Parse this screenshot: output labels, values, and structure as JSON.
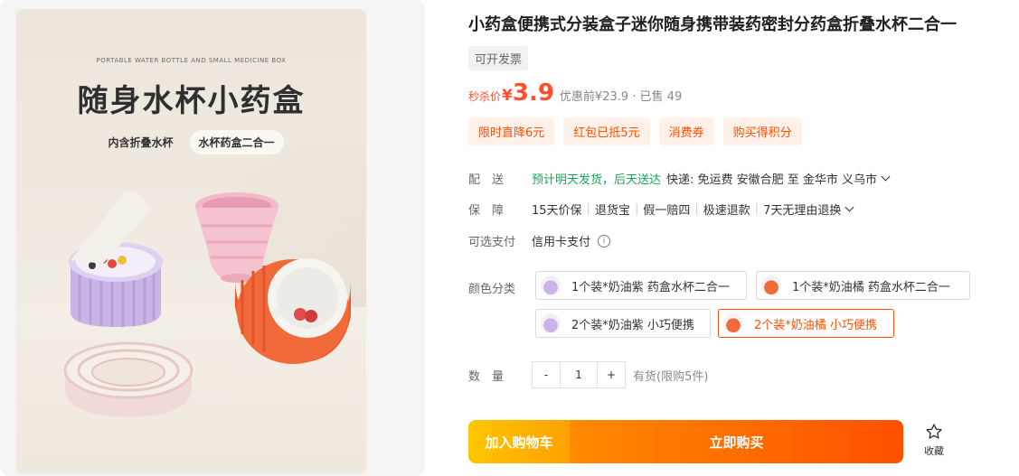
{
  "hero": {
    "subtitle_en": "PORTABLE WATER BOTTLE AND SMALL MEDICINE BOX",
    "headline": "随身水杯小药盒",
    "pill_1": "内含折叠水杯",
    "pill_2": "水杯药盒二合一"
  },
  "product": {
    "title": "小药盒便携式分装盒子迷你随身携带装药密封分药盒折叠水杯二合一",
    "invoice": "可开发票",
    "price_label": "秒杀价",
    "currency": "¥",
    "price": "3.9",
    "original": "优惠前¥23.9 · 已售 49",
    "tags": [
      "限时直降6元",
      "红包已抵5元",
      "消费券",
      "购买得积分"
    ]
  },
  "shipping": {
    "label": "配　送",
    "eta": "预计明天发货，后天送达",
    "detail": "快递: 免运费  安徽合肥  至  金华市 义乌市"
  },
  "guarantee": {
    "label": "保　障",
    "items": [
      "15天价保",
      "退货宝",
      "假一赔四",
      "极速退款",
      "7天无理由退换"
    ]
  },
  "payment": {
    "label": "可选支付",
    "value": "信用卡支付",
    "info_icon": "i"
  },
  "options": {
    "label": "颜色分类",
    "items": [
      {
        "text": "1个装*奶油紫 药盒水杯二合一",
        "color": "purple"
      },
      {
        "text": "1个装*奶油橘 药盒水杯二合一",
        "color": "orange"
      },
      {
        "text": "2个装*奶油紫 小巧便携",
        "color": "purple"
      },
      {
        "text": "2个装*奶油橘 小巧便携",
        "color": "orange",
        "selected": true
      }
    ]
  },
  "quantity": {
    "label": "数　量",
    "minus": "-",
    "value": "1",
    "plus": "+",
    "stock": "有货(限购5件)"
  },
  "actions": {
    "add_cart": "加入购物车",
    "buy_now": "立即购买",
    "favorite": "收藏"
  },
  "colors": {
    "accent": "#ff5000",
    "price": "#ff4f2e",
    "green": "#14a65a"
  }
}
